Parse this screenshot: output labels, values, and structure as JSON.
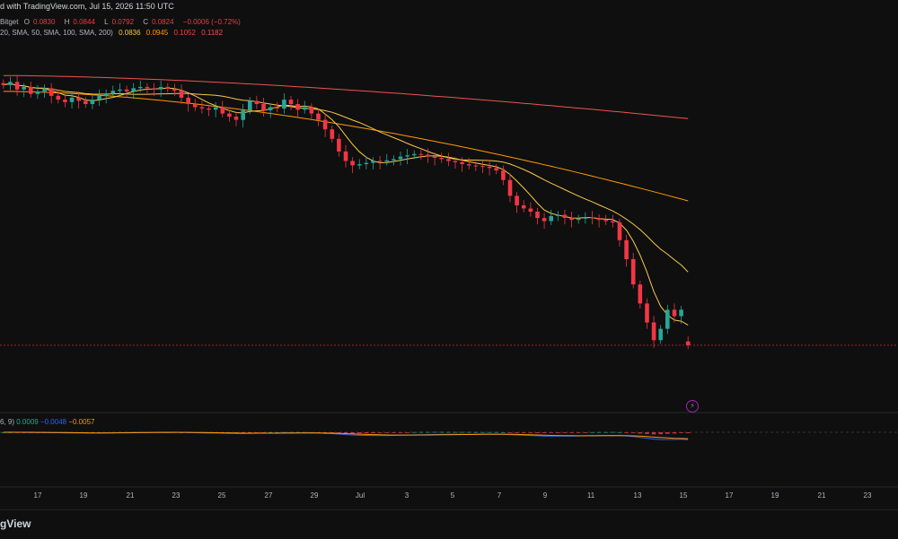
{
  "header": {
    "published": "d with TradingView.com, Jul 15, 2026 11:50 UTC"
  },
  "legend": {
    "exchange": "Bitget",
    "o_label": "O",
    "o_val": "0.0830",
    "h_label": "H",
    "h_val": "0.0844",
    "l_label": "L",
    "l_val": "0.0792",
    "c_label": "C",
    "c_val": "0.0824",
    "change": "−0.0006 (−0.72%)",
    "ma_params": "20, SMA, 50, SMA, 100, SMA, 200)",
    "ma_values": [
      "0.0836",
      "0.0945",
      "0.1052",
      "0.1182"
    ]
  },
  "macd_legend": {
    "params": "6, 9)",
    "hist": "0.0009",
    "macd": "−0.0048",
    "signal": "−0.0057"
  },
  "xaxis": {
    "labels": [
      "17",
      "19",
      "21",
      "23",
      "25",
      "27",
      "29",
      "Jul",
      "3",
      "5",
      "7",
      "9",
      "11",
      "13",
      "15",
      "17",
      "19",
      "21",
      "23"
    ]
  },
  "footer": {
    "brand": "gView"
  },
  "colors": {
    "up": "#26a69a",
    "down": "#f23645",
    "ma20": "#f7c948",
    "ma50": "#ff9800",
    "ma100": "#f44336",
    "ma200": "#ef5350",
    "macd": "#2962ff",
    "signal": "#ff9800"
  },
  "icons": {
    "alert": "lightning-icon"
  },
  "chart_data": {
    "type": "candlestick",
    "symbol_exchange": "Bitget",
    "x_labels": [
      "17",
      "19",
      "21",
      "23",
      "25",
      "27",
      "29",
      "Jul",
      "3",
      "5",
      "7",
      "9",
      "11",
      "13",
      "15",
      "17",
      "19",
      "21",
      "23"
    ],
    "current_close": 0.0824,
    "ohlc_last": {
      "open": 0.083,
      "high": 0.0844,
      "low": 0.0792,
      "close": 0.0824
    },
    "ma_last": {
      "ma20": 0.0836,
      "ma50": 0.0945,
      "ma100": 0.1052,
      "ma200": 0.1182
    },
    "closes": [
      0.1235,
      0.124,
      0.1228,
      0.1232,
      0.1221,
      0.1225,
      0.123,
      0.1218,
      0.1212,
      0.1208,
      0.1215,
      0.121,
      0.1205,
      0.1212,
      0.1218,
      0.1222,
      0.1226,
      0.1228,
      0.1225,
      0.123,
      0.1232,
      0.123,
      0.1228,
      0.1232,
      0.1229,
      0.1226,
      0.1215,
      0.1205,
      0.12,
      0.1198,
      0.1196,
      0.12,
      0.119,
      0.1185,
      0.118,
      0.1195,
      0.121,
      0.1205,
      0.1195,
      0.12,
      0.1198,
      0.1212,
      0.1205,
      0.1196,
      0.12,
      0.119,
      0.118,
      0.1165,
      0.115,
      0.113,
      0.1115,
      0.1108,
      0.111,
      0.1112,
      0.1115,
      0.1114,
      0.1116,
      0.1118,
      0.1122,
      0.1124,
      0.1126,
      0.1125,
      0.1122,
      0.112,
      0.1118,
      0.1115,
      0.1113,
      0.111,
      0.1108,
      0.1107,
      0.1106,
      0.1104,
      0.11,
      0.1085,
      0.106,
      0.1045,
      0.104,
      0.1035,
      0.1025,
      0.102,
      0.1028,
      0.103,
      0.1025,
      0.1022,
      0.1024,
      0.1026,
      0.1025,
      0.1022,
      0.102,
      0.1018,
      0.099,
      0.096,
      0.092,
      0.089,
      0.086,
      0.0832,
      0.085,
      0.088,
      0.087,
      0.088,
      0.0824
    ]
  }
}
